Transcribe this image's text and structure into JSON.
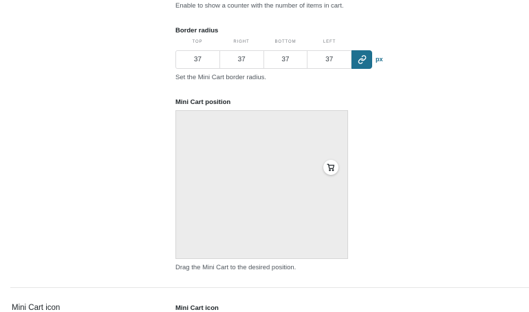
{
  "counter": {
    "help": "Enable to show a counter with the number of items in cart."
  },
  "border_radius": {
    "label": "Border radius",
    "headings": [
      "TOP",
      "RIGHT",
      "BOTTOM",
      "LEFT"
    ],
    "values": [
      "37",
      "37",
      "37",
      "37"
    ],
    "linked": true,
    "unit": "px",
    "help": "Set the Mini Cart border radius."
  },
  "position": {
    "label": "Mini Cart position",
    "handle_icon": "cart-icon",
    "help": "Drag the Mini Cart to the desired position."
  },
  "icon_section": {
    "title": "Mini Cart icon",
    "field_label": "Mini Cart icon"
  },
  "colors": {
    "accent": "#1e7090",
    "canvas": "#ececec"
  }
}
